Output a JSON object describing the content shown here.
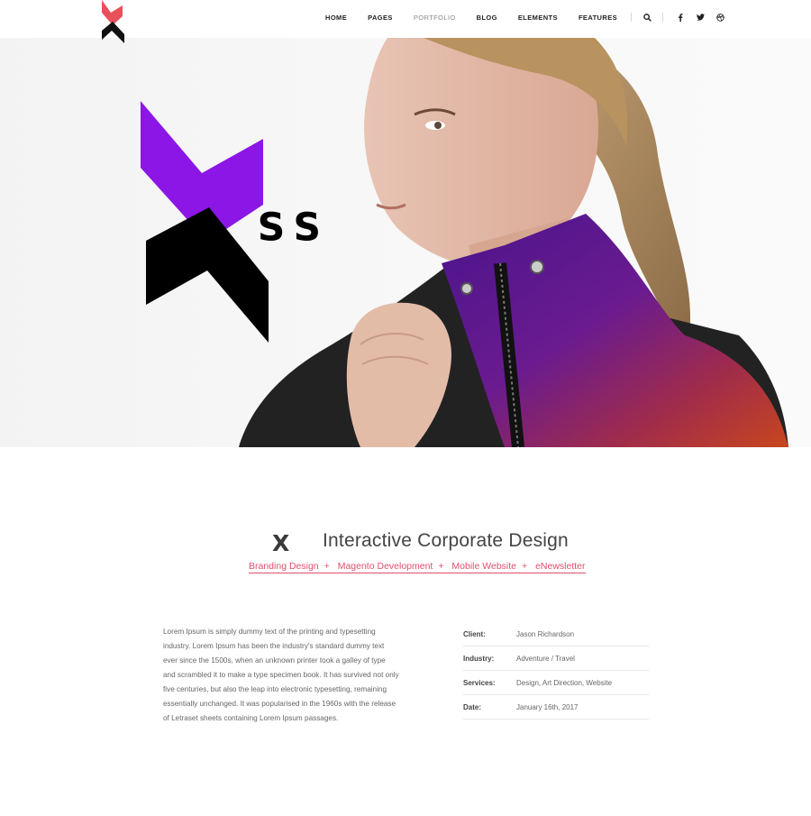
{
  "header": {
    "logo_name": "x-logo",
    "nav": [
      "HOME",
      "PAGES",
      "PORTFOLIO",
      "BLOG",
      "ELEMENTS",
      "FEATURES"
    ],
    "active_nav": "PORTFOLIO",
    "icons": [
      "search-icon",
      "facebook-icon",
      "twitter-icon",
      "dribbble-icon"
    ]
  },
  "hero": {
    "overlay_logo_text": "ss",
    "colors": {
      "purple": "#8c16e6",
      "black": "#000000",
      "jacket_purple": "#5a1a8a",
      "jacket_orange": "#c4421e"
    }
  },
  "project": {
    "mark": "X",
    "title": "Interactive Corporate Design",
    "tags": [
      "Branding Design",
      "Magento Development",
      "Mobile Website",
      "eNewsletter"
    ],
    "tag_separator": "+",
    "description": "Lorem Ipsum is simply dummy text of the printing and typesetting industry. Lorem Ipsum has been the industry's standard dummy text ever since the 1500s, when an unknown printer took a galley of type and scrambled it to make a type specimen book. It has survived not only five centuries, but also the leap into electronic typesetting, remaining essentially unchanged. It was popularised in the 1960s with the release of Letraset sheets containing Lorem Ipsum passages.",
    "details": [
      {
        "key": "Client:",
        "value": "Jason Richardson"
      },
      {
        "key": "Industry:",
        "value": "Adventure / Travel"
      },
      {
        "key": "Services:",
        "value": "Design, Art Direction, Website"
      },
      {
        "key": "Date:",
        "value": "January 16th, 2017"
      }
    ]
  },
  "accent_color": "#e0506e"
}
